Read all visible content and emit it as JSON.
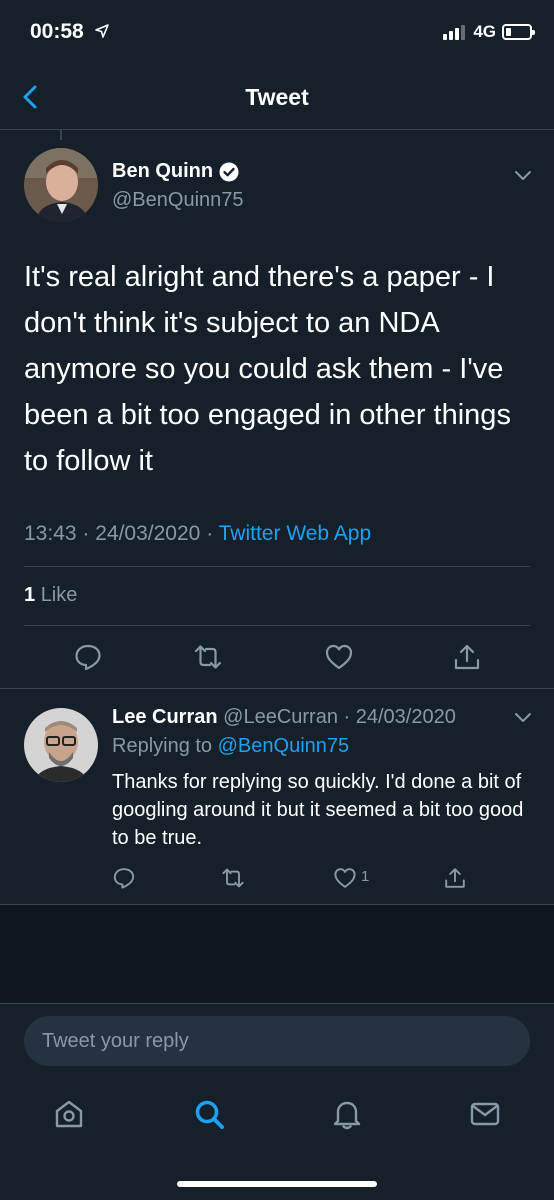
{
  "status_bar": {
    "time": "00:58",
    "network": "4G"
  },
  "header": {
    "title": "Tweet"
  },
  "tweet": {
    "author_name": "Ben Quinn",
    "author_handle": "@BenQuinn75",
    "text": "It's real alright and there's a paper - I don't think it's subject to an NDA anymore so you could ask them - I've been a bit too engaged in other things to follow it",
    "time": "13:43",
    "date": "24/03/2020",
    "source": "Twitter Web App",
    "like_count": "1",
    "like_label": "Like"
  },
  "reply": {
    "author_name": "Lee Curran",
    "author_handle": "@LeeCurran",
    "date": "24/03/2020",
    "replying_prefix": "Replying to",
    "replying_to": "@BenQuinn75",
    "text": "Thanks for replying so quickly. I'd done a bit of googling around it but it seemed a bit too good to be true.",
    "like_count": "1"
  },
  "compose": {
    "placeholder": "Tweet your reply"
  },
  "colors": {
    "background": "#15202b",
    "accent": "#1da1f2",
    "muted": "#8899a6",
    "border": "#38444d"
  },
  "icons": [
    "location-arrow-icon",
    "signal-icon",
    "battery-icon",
    "back-icon",
    "verified-icon",
    "chevron-down-icon",
    "reply-icon",
    "retweet-icon",
    "like-icon",
    "share-icon",
    "home-icon",
    "search-icon",
    "notifications-icon",
    "messages-icon"
  ]
}
